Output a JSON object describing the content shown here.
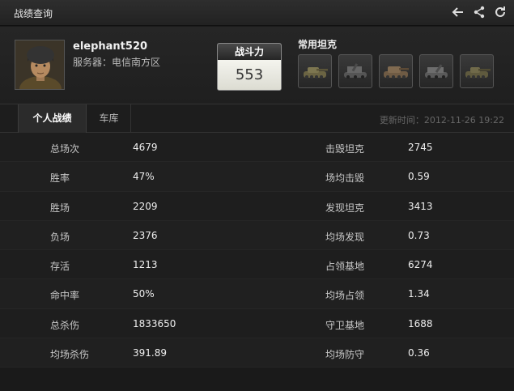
{
  "window": {
    "title": "战绩查询"
  },
  "profile": {
    "username": "elephant520",
    "server_label": "服务器：",
    "server": "电信南方区"
  },
  "power": {
    "label": "战斗力",
    "value": "553"
  },
  "tanks": {
    "label": "常用坦克",
    "items": [
      {
        "icon": "tank-icon"
      },
      {
        "icon": "spg-icon"
      },
      {
        "icon": "tank-icon"
      },
      {
        "icon": "spg-icon"
      },
      {
        "icon": "tank-icon"
      }
    ]
  },
  "tabs": [
    {
      "label": "个人战绩",
      "active": true
    },
    {
      "label": "车库",
      "active": false
    }
  ],
  "updated": {
    "label": "更新时间：",
    "value": "2012-11-26 19:22"
  },
  "stats": [
    {
      "l_label": "总场次",
      "l_value": "4679",
      "r_label": "击毁坦克",
      "r_value": "2745"
    },
    {
      "l_label": "胜率",
      "l_value": "47%",
      "r_label": "场均击毁",
      "r_value": "0.59"
    },
    {
      "l_label": "胜场",
      "l_value": "2209",
      "r_label": "发现坦克",
      "r_value": "3413"
    },
    {
      "l_label": "负场",
      "l_value": "2376",
      "r_label": "均场发现",
      "r_value": "0.73"
    },
    {
      "l_label": "存活",
      "l_value": "1213",
      "r_label": "占领基地",
      "r_value": "6274"
    },
    {
      "l_label": "命中率",
      "l_value": "50%",
      "r_label": "均场占领",
      "r_value": "1.34"
    },
    {
      "l_label": "总杀伤",
      "l_value": "1833650",
      "r_label": "守卫基地",
      "r_value": "1688"
    },
    {
      "l_label": "均场杀伤",
      "l_value": "391.89",
      "r_label": "均场防守",
      "r_value": "0.36"
    }
  ],
  "icons": {
    "back": "back-arrow-icon",
    "share": "share-icon",
    "refresh": "refresh-icon"
  }
}
